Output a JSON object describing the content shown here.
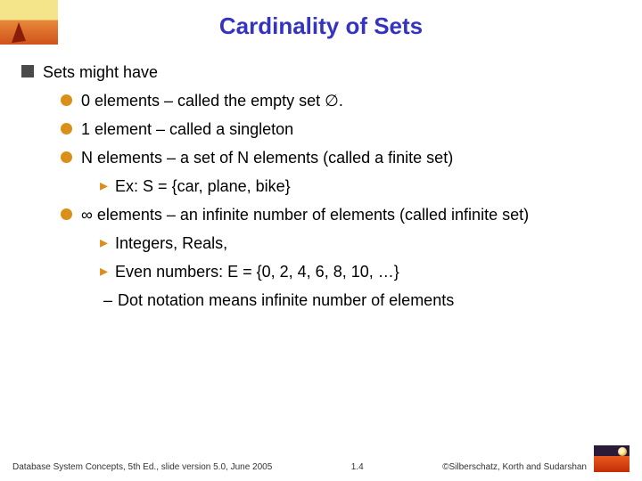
{
  "title": "Cardinality of Sets",
  "l1": "Sets might have",
  "b1": "0 elements – called the empty set ∅.",
  "b2": "1 element – called a singleton",
  "b3": "N elements – a set of N elements (called a finite set)",
  "ex1": "Ex:  S = {car, plane, bike}",
  "b4": "∞ elements – an infinite number of elements (called infinite set)",
  "ex2": "Integers, Reals,",
  "ex3": "Even numbers: E = {0, 2, 4, 6, 8, 10, …}",
  "dash1": "Dot notation means infinite number of elements",
  "footer_left": "Database System Concepts, 5th Ed., slide version 5.0, June 2005",
  "footer_center": "1.4",
  "footer_right": "©Silberschatz, Korth and Sudarshan"
}
